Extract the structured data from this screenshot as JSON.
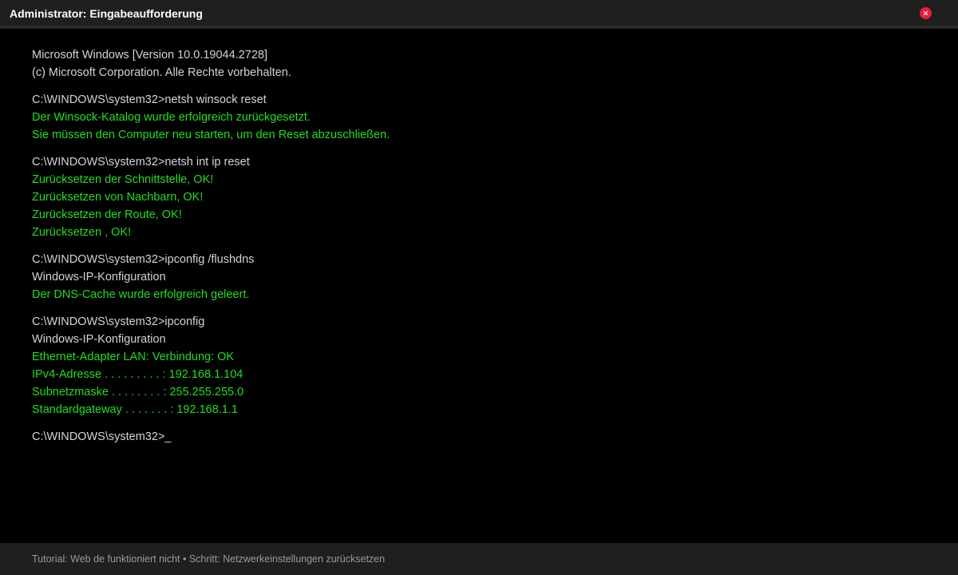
{
  "window": {
    "title": "Administrator: Eingabeaufforderung",
    "close_icon": "close-icon",
    "close_color": "#e81f3f"
  },
  "colors": {
    "background": "#000000",
    "output_text": "#d4d4d4",
    "success_text": "#22dd22",
    "status_text": "#9a9a9a"
  },
  "terminal": {
    "header": [
      "Microsoft Windows [Version 10.0.19044.2728]",
      "(c) Microsoft Corporation. Alle Rechte vorbehalten."
    ],
    "blocks": [
      {
        "command": "C:\\WINDOWS\\system32>netsh winsock reset",
        "output": [
          {
            "text": "Der Winsock-Katalog wurde erfolgreich zurückgesetzt.",
            "style": "ok"
          },
          {
            "text": "Sie müssen den Computer neu starten, um den Reset abzuschließen.",
            "style": "ok"
          }
        ]
      },
      {
        "command": "C:\\WINDOWS\\system32>netsh int ip reset",
        "output": [
          {
            "text": "Zurücksetzen der Schnittstelle, OK!",
            "style": "ok"
          },
          {
            "text": "Zurücksetzen von Nachbarn, OK!",
            "style": "ok"
          },
          {
            "text": "Zurücksetzen der Route, OK!",
            "style": "ok"
          },
          {
            "text": "Zurücksetzen , OK!",
            "style": "ok"
          }
        ]
      },
      {
        "command": "C:\\WINDOWS\\system32>ipconfig /flushdns",
        "output": [
          {
            "text": "Windows-IP-Konfiguration",
            "style": "normal"
          },
          {
            "text": "Der DNS-Cache wurde erfolgreich geleert.",
            "style": "ok"
          }
        ]
      },
      {
        "command": "C:\\WINDOWS\\system32>ipconfig",
        "output": [
          {
            "text": "Windows-IP-Konfiguration",
            "style": "normal"
          },
          {
            "text": "Ethernet-Adapter LAN: Verbindung: OK",
            "style": "ok"
          },
          {
            "text": "IPv4-Adresse . . . . . . . . . : 192.168.1.104",
            "style": "ok"
          },
          {
            "text": "Subnetzmaske . . . . . . . . : 255.255.255.0",
            "style": "ok"
          },
          {
            "text": "Standardgateway . . . . . . . : 192.168.1.1",
            "style": "ok"
          }
        ]
      }
    ],
    "current_prompt": "C:\\WINDOWS\\system32>_"
  },
  "statusbar": {
    "text": "Tutorial: Web de funktioniert nicht • Schritt: Netzwerkeinstellungen zurücksetzen"
  }
}
